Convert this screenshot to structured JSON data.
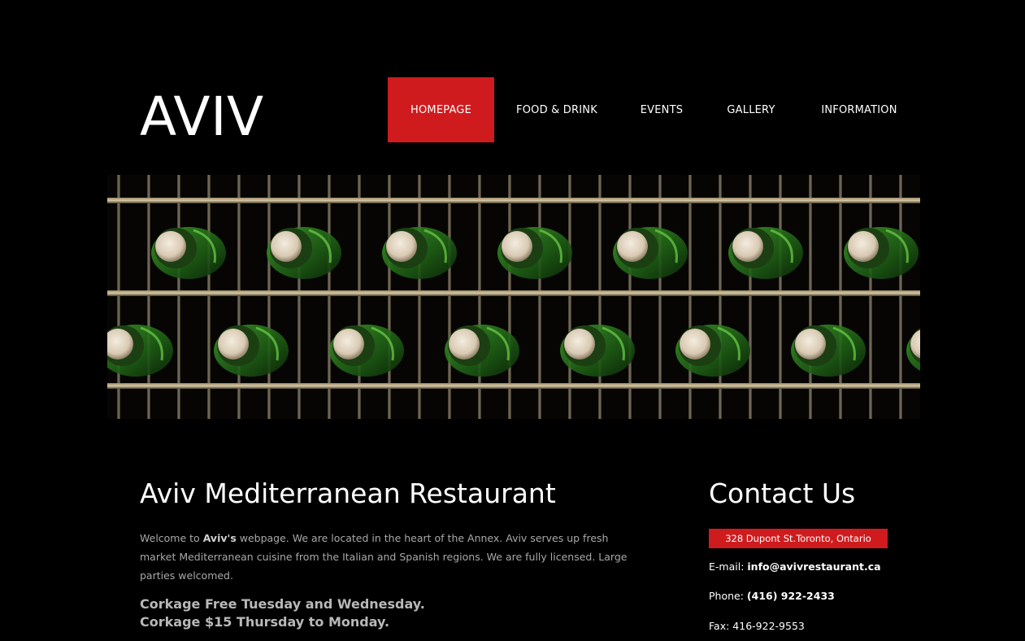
{
  "site": {
    "logo": "AVIV"
  },
  "nav": {
    "items": [
      {
        "label": "HOMEPAGE",
        "active": true
      },
      {
        "label": "FOOD & DRINK",
        "active": false
      },
      {
        "label": "EVENTS",
        "active": false
      },
      {
        "label": "GALLERY",
        "active": false
      },
      {
        "label": "INFORMATION",
        "active": false
      }
    ]
  },
  "hero": {
    "image": "wine-bottles-rack-photo"
  },
  "main": {
    "title": "Aviv Mediterranean Restaurant",
    "welcome_prefix": "Welcome to ",
    "welcome_brand": "Aviv's",
    "welcome_rest": " webpage. We are located in the heart of the Annex. Aviv serves up fresh market Mediterranean cuisine from the Italian and Spanish regions. We are fully licensed. Large parties welcomed.",
    "corkage_line1": "Corkage Free Tuesday and Wednesday.",
    "corkage_line2": "Corkage $15 Thursday to Monday."
  },
  "contact": {
    "title": "Contact Us",
    "address": "328 Dupont St.Toronto, Ontario",
    "email_label": "E-mail: ",
    "email_value": "info@avivrestaurant.ca",
    "phone_label": "Phone: ",
    "phone_value": "(416) 922-2433",
    "fax_label": "Fax: ",
    "fax_value": "416-922-9553"
  },
  "colors": {
    "accent": "#cf1b1e",
    "background": "#000000",
    "body_text": "#a8a8a8"
  }
}
